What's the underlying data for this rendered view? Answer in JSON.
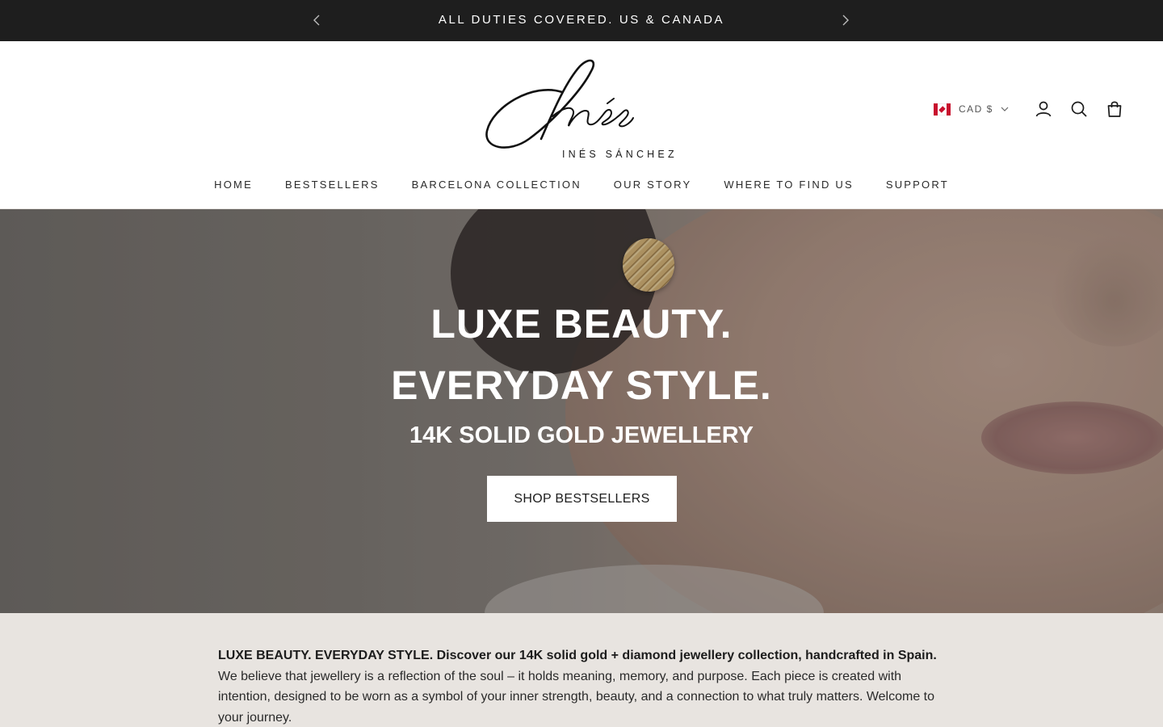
{
  "announcement": {
    "text": "ALL DUTIES COVERED. US & CANADA",
    "prev_icon": "chevron-left-icon",
    "next_icon": "chevron-right-icon"
  },
  "brand": {
    "name": "INÉS SÁNCHEZ",
    "logo_script": "Inés"
  },
  "header": {
    "currency_label": "CAD $",
    "currency_flag": "canada-flag-icon",
    "icons": [
      "account-icon",
      "search-icon",
      "cart-icon"
    ]
  },
  "nav": {
    "items": [
      {
        "label": "HOME"
      },
      {
        "label": "BESTSELLERS"
      },
      {
        "label": "BARCELONA COLLECTION"
      },
      {
        "label": "OUR STORY"
      },
      {
        "label": "WHERE TO FIND US"
      },
      {
        "label": "SUPPORT"
      }
    ]
  },
  "hero": {
    "title_line1": "LUXE BEAUTY.",
    "title_line2": "EVERYDAY STYLE.",
    "subtitle": "14K SOLID GOLD JEWELLERY",
    "button_label": "SHOP BESTSELLERS"
  },
  "intro": {
    "bold": "LUXE BEAUTY. EVERYDAY STYLE. Discover our 14K solid gold + diamond jewellery collection, handcrafted in Spain.",
    "body": " We believe that jewellery is a reflection of the soul – it holds meaning, memory, and purpose. Each piece is created with intention, designed to be worn as a symbol of your inner strength, beauty, and a connection to what truly matters. Welcome to your journey."
  },
  "colors": {
    "announcement_bg": "#1e1e1e",
    "intro_bg": "#e8e4e0",
    "text": "#1c1c1c"
  }
}
